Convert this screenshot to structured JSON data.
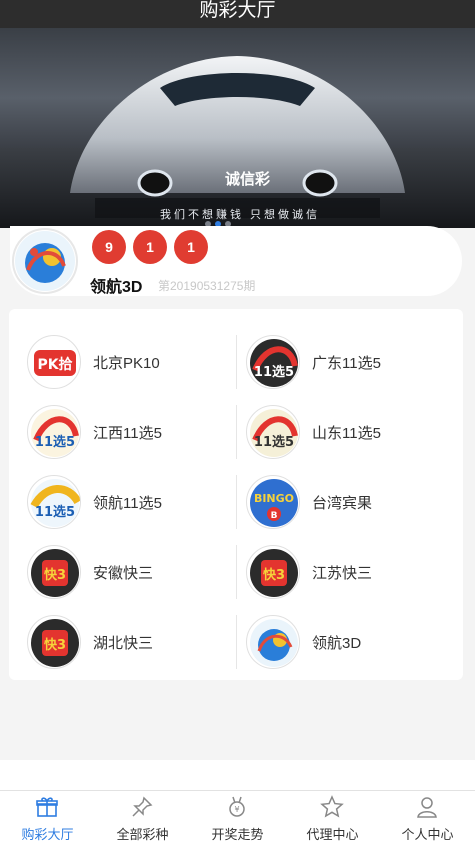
{
  "header": {
    "title": "购彩大厅"
  },
  "banner": {
    "brand": "诚信彩",
    "slogan": "我们不想赚钱 只想做诚信",
    "slide_count": 3,
    "active_slide": 2
  },
  "latest_draw": {
    "balls": [
      "9",
      "1",
      "1"
    ],
    "name": "领航3D",
    "issue": "第20190531275期",
    "ball_color": "#e03c31"
  },
  "lotteries": [
    {
      "name": "北京PK10",
      "icon": "pk10-icon"
    },
    {
      "name": "广东11选5",
      "icon": "eleven-five-icon"
    },
    {
      "name": "江西11选5",
      "icon": "eleven-five-icon"
    },
    {
      "name": "山东11选5",
      "icon": "eleven-five-icon"
    },
    {
      "name": "领航11选5",
      "icon": "eleven-five-icon"
    },
    {
      "name": "台湾宾果",
      "icon": "bingo-icon"
    },
    {
      "name": "安徽快三",
      "icon": "kuai3-icon"
    },
    {
      "name": "江苏快三",
      "icon": "kuai3-icon"
    },
    {
      "name": "湖北快三",
      "icon": "kuai3-icon"
    },
    {
      "name": "领航3D",
      "icon": "3d-icon"
    }
  ],
  "tabs": [
    {
      "label": "购彩大厅",
      "icon": "gift-icon",
      "active": true
    },
    {
      "label": "全部彩种",
      "icon": "pin-icon",
      "active": false
    },
    {
      "label": "开奖走势",
      "icon": "medal-icon",
      "active": false
    },
    {
      "label": "代理中心",
      "icon": "star-icon",
      "active": false
    },
    {
      "label": "个人中心",
      "icon": "user-icon",
      "active": false
    }
  ],
  "colors": {
    "accent": "#2f7de1",
    "topbar": "#2d2d2d",
    "ball": "#e03c31"
  }
}
